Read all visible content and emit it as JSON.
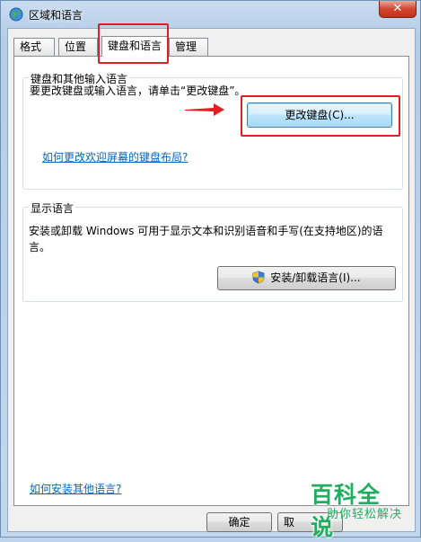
{
  "window": {
    "title": "区域和语言",
    "close_label": "✕"
  },
  "tabs": [
    {
      "label": "格式"
    },
    {
      "label": "位置"
    },
    {
      "label": "键盘和语言"
    },
    {
      "label": "管理"
    }
  ],
  "keyboard_group": {
    "label": "键盘和其他输入语言",
    "description": "要更改键盘或输入语言，请单击“更改键盘”。",
    "change_keyboard_button": "更改键盘(C)...",
    "welcome_screen_link": "如何更改欢迎屏幕的键盘布局?"
  },
  "display_language_group": {
    "label": "显示语言",
    "description_line1": "安装或卸载 Windows 可用于显示文本和识别语音和手写(在支持地区)的语",
    "description_line2": "言。",
    "install_button": "安装/卸载语言(I)..."
  },
  "footer": {
    "install_languages_link": "如何安装其他语言?",
    "ok_button": "确定",
    "cancel_button_partial": "取"
  },
  "watermark": {
    "title": "百科全说",
    "subtitle": "助你轻松解决"
  },
  "colors": {
    "annotation_red": "#e02020",
    "link_blue": "#0066cc",
    "watermark_green": "#1fae5f"
  }
}
